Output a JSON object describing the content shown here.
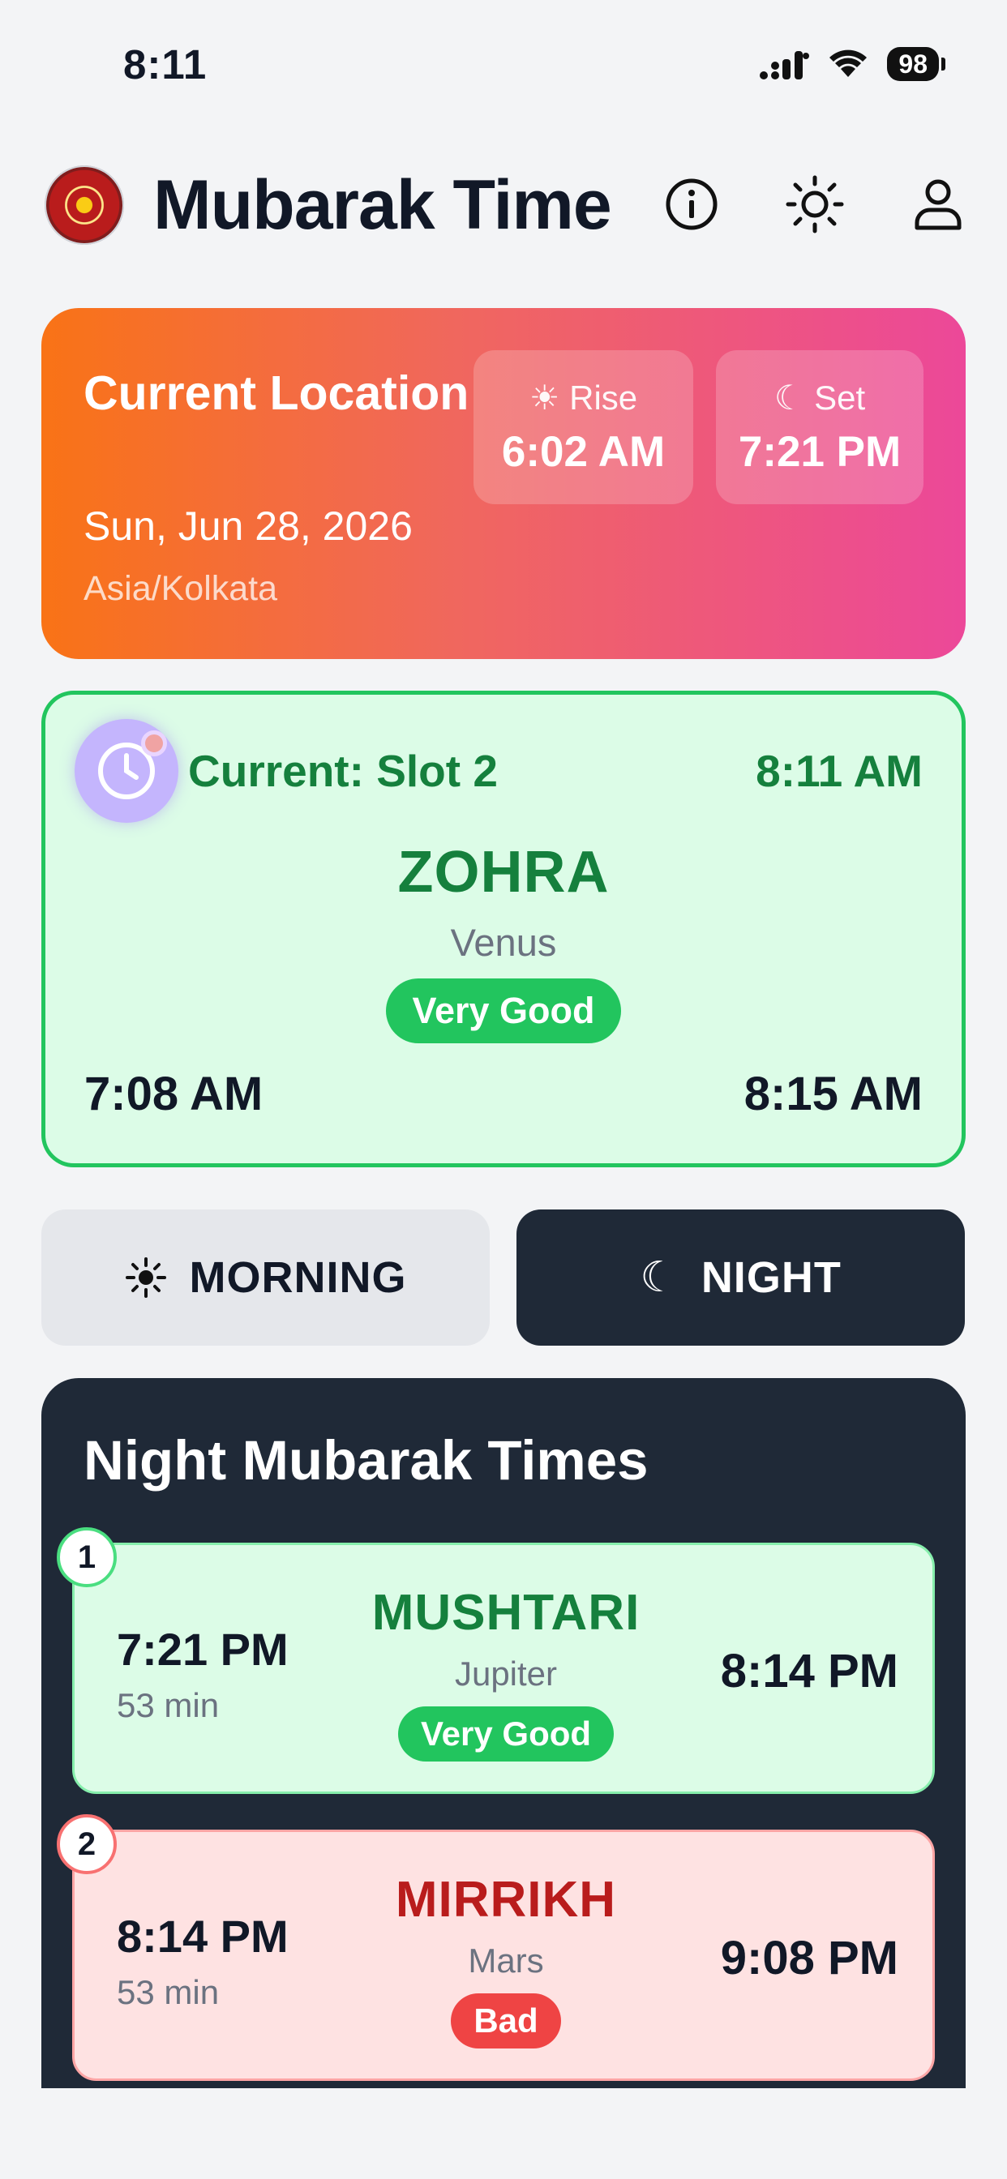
{
  "status_bar": {
    "time": "8:11",
    "battery": "98"
  },
  "header": {
    "title": "Mubarak Time"
  },
  "location": {
    "title": "Current Location",
    "date": "Sun, Jun 28, 2026",
    "timezone": "Asia/Kolkata",
    "rise_label": "☀ Rise",
    "rise_time": "6:02 AM",
    "set_label": "☾ Set",
    "set_time": "7:21 PM"
  },
  "current": {
    "slot_label": "Current: Slot 2",
    "now": "8:11 AM",
    "planet": "ZOHRA",
    "planet_english": "Venus",
    "rating": "Very Good",
    "start": "7:08 AM",
    "end": "8:15 AM"
  },
  "toggle": {
    "morning": "MORNING",
    "night": "NIGHT",
    "selected": "night"
  },
  "night": {
    "title": "Night Mubarak Times",
    "slots": [
      {
        "number": "1",
        "start": "7:21 PM",
        "duration": "53 min",
        "planet": "MUSHTARI",
        "planet_english": "Jupiter",
        "rating": "Very Good",
        "end": "8:14 PM"
      },
      {
        "number": "2",
        "start": "8:14 PM",
        "duration": "53 min",
        "planet": "MIRRIKH",
        "planet_english": "Mars",
        "rating": "Bad",
        "end": "9:08 PM"
      }
    ]
  },
  "colors": {
    "good": "#22c55e",
    "bad": "#ef4444",
    "dark": "#1f2937",
    "gradient_start": "#f97316",
    "gradient_end": "#ec4899"
  }
}
